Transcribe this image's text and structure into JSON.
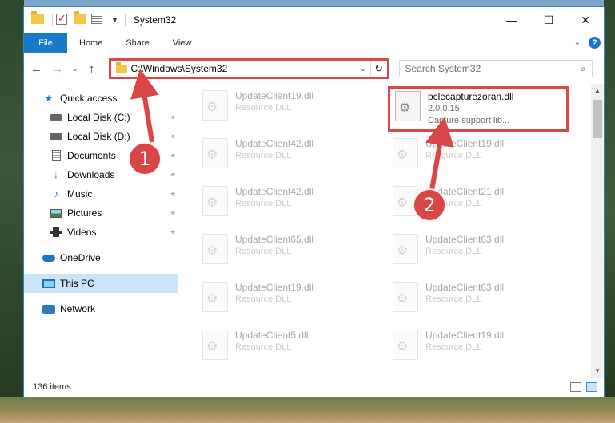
{
  "window": {
    "title": "System32",
    "controls": {
      "minimize": "—",
      "maximize": "☐",
      "close": "✕"
    }
  },
  "ribbon": {
    "tabs": [
      "File",
      "Home",
      "Share",
      "View"
    ],
    "help": "?",
    "expand": "⌄"
  },
  "navigation": {
    "back": "←",
    "forward": "→",
    "recent": "⌄",
    "up": "↑",
    "address": "C:\\Windows\\System32",
    "address_dropdown": "⌄",
    "refresh": "↻",
    "search_placeholder": "Search System32",
    "search_icon": "⌕"
  },
  "sidebar": {
    "quick_access": "Quick access",
    "items": [
      {
        "label": "Local Disk (C:)",
        "icon": "disk-icon",
        "pinned": true
      },
      {
        "label": "Local Disk (D:)",
        "icon": "disk-icon",
        "pinned": true
      },
      {
        "label": "Documents",
        "icon": "documents-icon",
        "pinned": true
      },
      {
        "label": "Downloads",
        "icon": "downloads-icon",
        "pinned": true
      },
      {
        "label": "Music",
        "icon": "music-icon",
        "pinned": true
      },
      {
        "label": "Pictures",
        "icon": "pictures-icon",
        "pinned": true
      },
      {
        "label": "Videos",
        "icon": "videos-icon",
        "pinned": true
      }
    ],
    "onedrive": "OneDrive",
    "this_pc": "This PC",
    "network": "Network",
    "pin_glyph": "⌖"
  },
  "files": {
    "highlighted": {
      "name": "pclecapturezoran.dll",
      "version": "2.0.0.15",
      "description": "Capture support lib..."
    },
    "left_column": [
      {
        "name": "UpdateClient19.dll",
        "desc": "Resource DLL"
      },
      {
        "name": "UpdateClient42.dll",
        "desc": "Resource DLL"
      },
      {
        "name": "UpdateClient42.dll",
        "desc": "Resource DLL"
      },
      {
        "name": "UpdateClient65.dll",
        "desc": "Resource DLL"
      },
      {
        "name": "UpdateClient19.dll",
        "desc": "Resource DLL"
      },
      {
        "name": "UpdateClient5.dll",
        "desc": "Resource DLL"
      }
    ],
    "right_column": [
      {
        "name": "UpdateClient19.dll",
        "desc": "Resource DLL"
      },
      {
        "name": "UpdateClient21.dll",
        "desc": "Resource DLL"
      },
      {
        "name": "UpdateClient63.dll",
        "desc": "Resource DLL"
      },
      {
        "name": "UpdateClient63.dll",
        "desc": "Resource DLL"
      },
      {
        "name": "UpdateClient19.dll",
        "desc": "Resource DLL"
      }
    ]
  },
  "status": {
    "item_count": "136 items"
  },
  "annotations": {
    "step1": "1",
    "step2": "2"
  },
  "colors": {
    "accent": "#1979ca",
    "highlight_red": "#d84a4a",
    "selected": "#cce4f7"
  }
}
